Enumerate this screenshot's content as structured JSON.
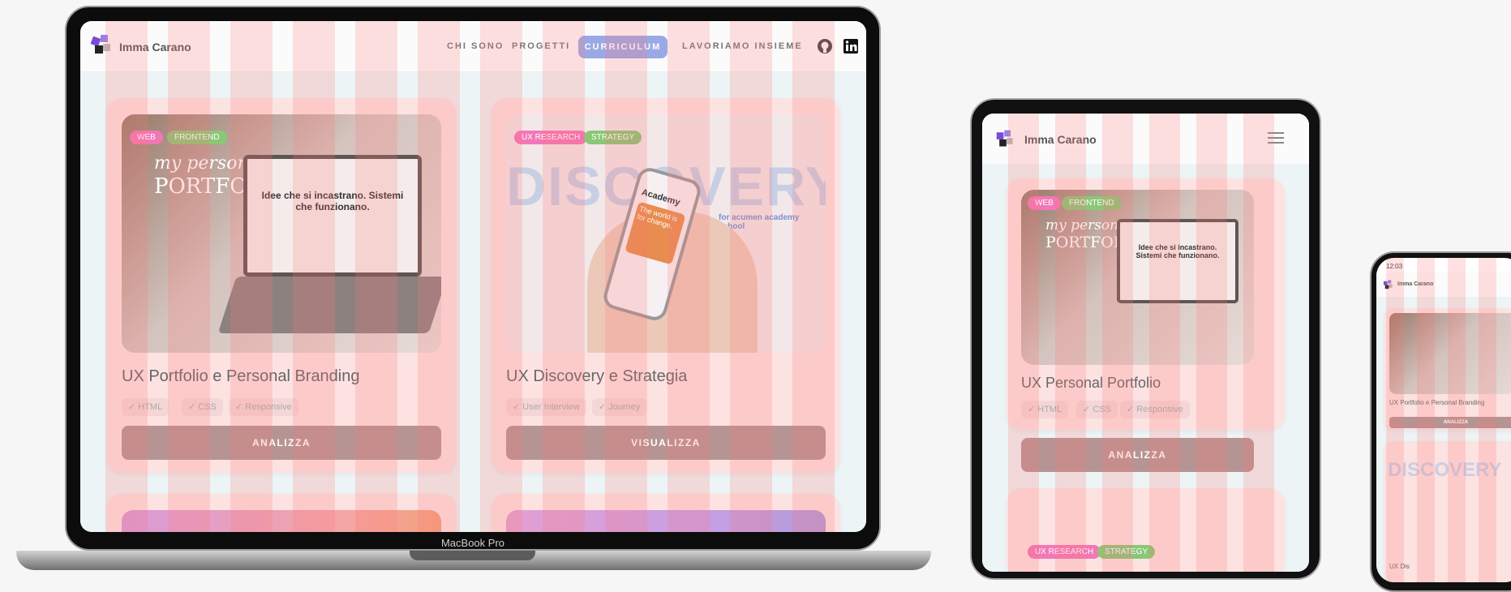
{
  "laptop": {
    "device_label": "MacBook Pro",
    "brand": "Imma Carano",
    "nav": [
      "CHI SONO",
      "PROGETTI",
      "CURRICULUM",
      "LAVORIAMO INSIEME"
    ],
    "cards": [
      {
        "tags": [
          "WEB",
          "FRONTEND"
        ],
        "title": "UX Portfolio e Personal Branding",
        "chips": [
          "✓ HTML",
          "✓ CSS",
          "✓ Responsive"
        ],
        "cta": "ANALIZZA",
        "img_heading_1": "my personal",
        "img_heading_2": "PORTFOLIO",
        "img_screen_text": "Idee che si incastrano. Sistemi che funzionano."
      },
      {
        "tags": [
          "UX RESEARCH",
          "STRATEGY"
        ],
        "title": "UX Discovery e Strategia",
        "chips": [
          "✓ User Interview",
          "✓ Journey"
        ],
        "cta": "VISUALIZZA",
        "img_word": "DISCOVERY",
        "img_caption": "for acumen academy school",
        "phone_heading": "Academy",
        "phone_text": "The world is for change."
      }
    ]
  },
  "tablet": {
    "brand": "Imma Carano",
    "card": {
      "tags": [
        "WEB",
        "FRONTEND"
      ],
      "title": "UX Personal Portfolio",
      "chips": [
        "✓ HTML",
        "✓ CSS",
        "✓ Responsive"
      ],
      "cta": "ANALIZZA",
      "img_heading_1": "my personal",
      "img_heading_2": "PORTFOLIO",
      "img_screen_text": "Idee che si incastrano. Sistemi che funzionano."
    },
    "next_tags": [
      "UX RESEARCH",
      "STRATEGY"
    ]
  },
  "phone": {
    "time": "12:03",
    "brand": "Imma Carano",
    "card_title": "UX Portfolio e Personal Branding",
    "cta": "ANALIZZA",
    "word": "DISCOVERY",
    "next_title": "UX Dis"
  },
  "colors": {
    "card_bg": "#fde2e2",
    "tag_pink": "#f277b7",
    "tag_green": "#8ac776",
    "cta_bg": "#b79494",
    "cv_button": "#9aa9e6",
    "page_bg": "#edf4f5"
  }
}
